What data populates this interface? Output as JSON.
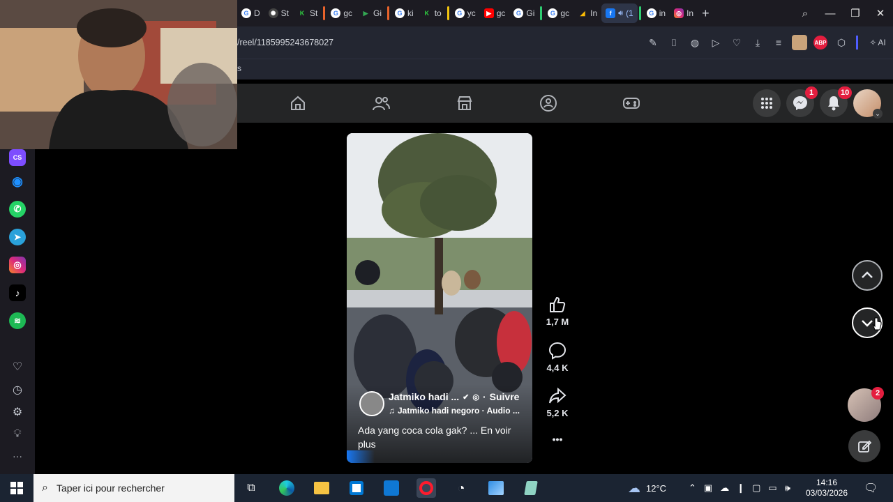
{
  "browser": {
    "tabs": [
      {
        "label": "D",
        "icon": "google-icon"
      },
      {
        "label": "St",
        "icon": "openai-icon"
      },
      {
        "label": "St",
        "icon": "k-icon"
      },
      {
        "label": "gc",
        "icon": "google-icon"
      },
      {
        "label": "Gi",
        "icon": "play-icon"
      },
      {
        "label": "ki",
        "icon": "google-icon"
      },
      {
        "label": "to",
        "icon": "k-icon"
      },
      {
        "label": "yc",
        "icon": "google-icon"
      },
      {
        "label": "gc",
        "icon": "youtube-icon"
      },
      {
        "label": "Gi",
        "icon": "google-icon"
      },
      {
        "label": "gc",
        "icon": "google-icon"
      },
      {
        "label": "In",
        "icon": "ads-icon"
      },
      {
        "label": "(1",
        "icon": "facebook-icon",
        "active": true
      },
      {
        "label": "in",
        "icon": "google-icon"
      },
      {
        "label": "In",
        "icon": "instagram-icon"
      }
    ],
    "url": "/reel/1185995243678027",
    "bookmark_fragment": "s",
    "ai_label": "AI",
    "abp_label": "ABP"
  },
  "fb": {
    "messenger_badge": "1",
    "notifications_badge": "10",
    "pages_badge": "2"
  },
  "reel": {
    "author": "Jatmiko hadi ...",
    "follow": "Suivre",
    "separator": "·",
    "audio": "Jatmiko hadi negoro · Audio ...",
    "caption": "Ada yang coca cola gak? ... En voir plus",
    "likes": "1,7 M",
    "comments": "4,4 K",
    "shares": "5,2 K",
    "more": "•••"
  },
  "taskbar": {
    "search_placeholder": "Taper ici pour rechercher",
    "temperature": "12°C",
    "time": "14:16",
    "date": "03/03/2026"
  },
  "colors": {
    "fb_bg": "#242526",
    "accent_blue": "#1877f2",
    "badge_red": "#e41e3f"
  }
}
